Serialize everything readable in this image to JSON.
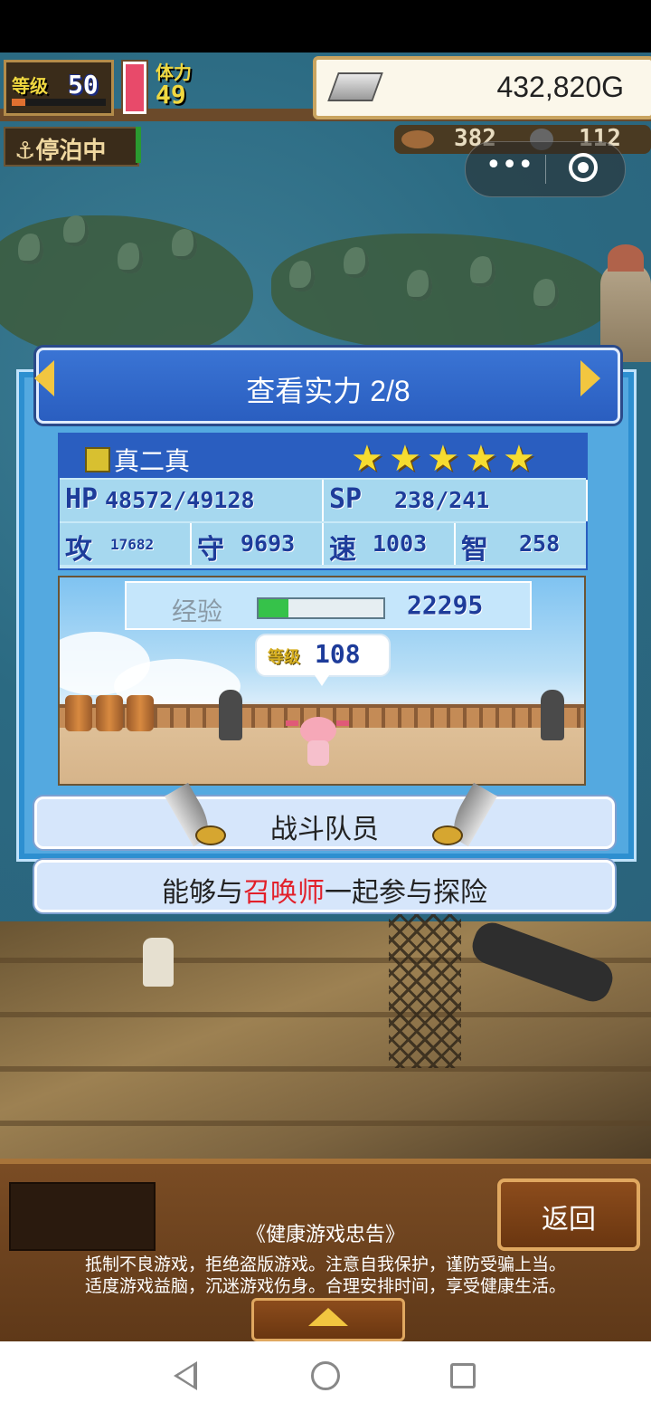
{
  "hud": {
    "level_label": "等级",
    "level_value": "50",
    "stamina_label": "体力",
    "stamina_value": "49",
    "gold_value": "432,820G",
    "dock_status": "停泊中",
    "food_count": "382",
    "gem_count": "112"
  },
  "dialog": {
    "title": "查看实力 2/8",
    "character": {
      "name": "真二真",
      "stars": 5,
      "hp_label": "HP",
      "hp_value": "48572/49128",
      "sp_label": "SP",
      "sp_value": "238/241",
      "atk_label": "攻",
      "atk_value": "17682",
      "def_label": "守",
      "def_value": "9693",
      "spd_label": "速",
      "spd_value": "1003",
      "int_label": "智",
      "int_value": "258"
    },
    "exp_label": "经验",
    "exp_value": "22295",
    "exp_progress": 0.24,
    "level_bubble_label": "等级",
    "level_bubble_value": "108",
    "role": "战斗队员",
    "desc_before": "能够与",
    "desc_highlight": "召唤师",
    "desc_after": "一起参与探险"
  },
  "bottom": {
    "back_label": "返回",
    "health_title": "《健康游戏忠告》",
    "health_line1": "抵制不良游戏，拒绝盗版游戏。注意自我保护，谨防受骗上当。",
    "health_line2": "适度游戏益脑，沉迷游戏伤身。合理安排时间，享受健康生活。"
  },
  "colors": {
    "title_blue": "#2a5ec0",
    "panel_blue": "#54a9e0",
    "highlight_red": "#e2202a",
    "star_yellow": "#f6dc30"
  }
}
